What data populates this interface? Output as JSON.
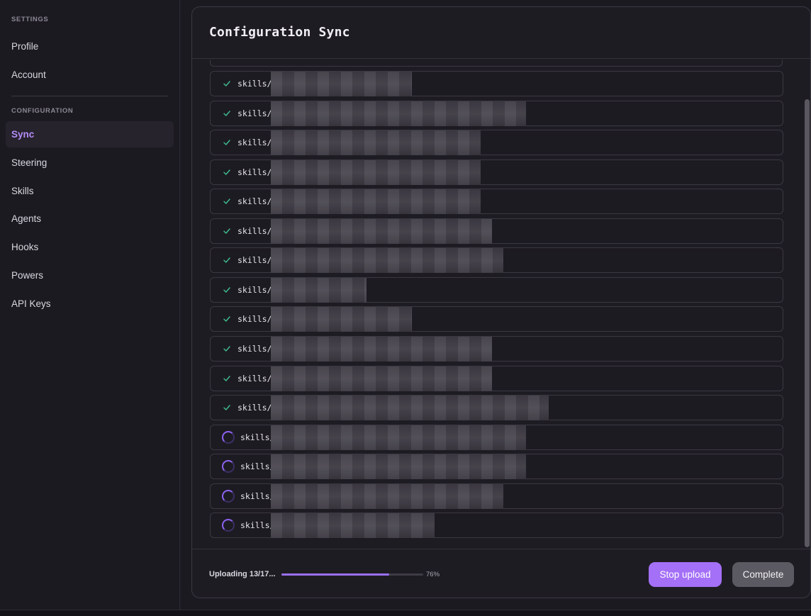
{
  "sidebar": {
    "settings_label": "SETTINGS",
    "settings_items": [
      {
        "label": "Profile"
      },
      {
        "label": "Account"
      }
    ],
    "configuration_label": "CONFIGURATION",
    "configuration_items": [
      {
        "label": "Sync",
        "active": true
      },
      {
        "label": "Steering"
      },
      {
        "label": "Skills"
      },
      {
        "label": "Agents"
      },
      {
        "label": "Hooks"
      },
      {
        "label": "Powers"
      },
      {
        "label": "API Keys"
      }
    ]
  },
  "panel": {
    "title": "Configuration Sync",
    "files": [
      {
        "path": "skills/c",
        "status": "done",
        "redact_width": 199
      },
      {
        "path": "skills/c",
        "status": "done",
        "redact_width": 360
      },
      {
        "path": "skills/c",
        "status": "done",
        "redact_width": 296
      },
      {
        "path": "skills/c",
        "status": "done",
        "redact_width": 296
      },
      {
        "path": "skills/c",
        "status": "done",
        "redact_width": 296
      },
      {
        "path": "skills/c",
        "status": "done",
        "redact_width": 312
      },
      {
        "path": "skills/c",
        "status": "done",
        "redact_width": 328
      },
      {
        "path": "skills/p",
        "status": "done",
        "redact_width": 135
      },
      {
        "path": "skills/c",
        "status": "done",
        "redact_width": 199
      },
      {
        "path": "skills/c",
        "status": "done",
        "redact_width": 312
      },
      {
        "path": "skills/c",
        "status": "done",
        "redact_width": 312
      },
      {
        "path": "skills/c",
        "status": "done",
        "redact_width": 392
      },
      {
        "path": "skills/",
        "status": "uploading",
        "redact_width": 360
      },
      {
        "path": "skills/",
        "status": "uploading",
        "redact_width": 360
      },
      {
        "path": "skills/",
        "status": "uploading",
        "redact_width": 328
      },
      {
        "path": "skills/",
        "status": "uploading",
        "redact_width": 231
      }
    ]
  },
  "footer": {
    "status_text": "Uploading 13/17...",
    "progress_percent": 76,
    "progress_label": "76%",
    "stop_label": "Stop upload",
    "complete_label": "Complete"
  },
  "colors": {
    "accent": "#a470f7",
    "check": "#3fbf8f",
    "spinner": "#8d63f2"
  }
}
